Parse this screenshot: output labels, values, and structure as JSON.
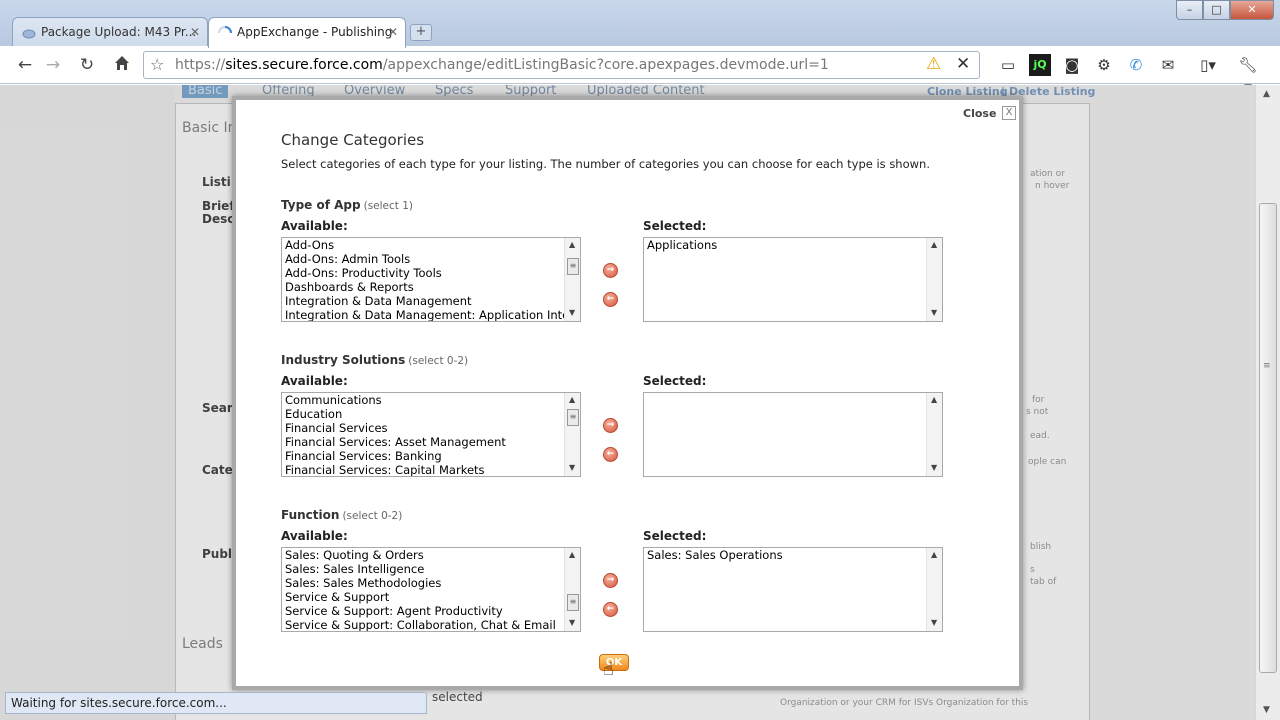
{
  "browser": {
    "tabs": [
      {
        "title": "Package Upload: M43 Pr...",
        "active": false
      },
      {
        "title": "AppExchange - Publishing",
        "active": true
      }
    ],
    "new_tab_symbol": "+",
    "url_scheme": "https://",
    "url_host": "sites.secure.force.com",
    "url_path": "/appexchange/editListingBasic?core.apexpages.devmode.url=1",
    "status_text": "Waiting for sites.secure.force.com...",
    "window_controls": {
      "minimize": "–",
      "maximize": "□",
      "close": "✕"
    },
    "extension_icons": [
      "window-icon",
      "jq-icon",
      "camera-icon",
      "gear-icon",
      "phone-icon",
      "gmail-icon",
      "page-icon",
      "wrench-icon"
    ]
  },
  "page_behind": {
    "tabs": [
      "Basic",
      "Offering",
      "Overview",
      "Specs",
      "Support",
      "Uploaded Content"
    ],
    "links": [
      "Clone Listing",
      "Delete Listing"
    ],
    "separator": "|",
    "sections": [
      "Basic In",
      "Leads"
    ],
    "labels": [
      "Listi",
      "Brief",
      "Desc",
      "Sear",
      "Cate",
      "Publ"
    ],
    "side_notes": [
      "ation or",
      "n hover",
      "for",
      "s not",
      "ead.",
      "ople can",
      "blish",
      "s",
      "tab of"
    ],
    "bottom_text": "selected",
    "bottom_note_1": "Organization or your CRM for ISVs Organization for this",
    "selected_tab": "Basic"
  },
  "modal": {
    "close_label": "Close",
    "close_x": "X",
    "title": "Change Categories",
    "description": "Select categories of each type for your listing. The number of categories you can choose for each type is shown.",
    "available_label": "Available:",
    "selected_label": "Selected:",
    "ok_label": "OK",
    "categories": [
      {
        "title": "Type of App",
        "hint": "(select 1)",
        "available": [
          "Add-Ons",
          "Add-Ons: Admin Tools",
          "Add-Ons: Productivity Tools",
          "Dashboards & Reports",
          "Integration & Data Management",
          "Integration & Data Management: Application Inte"
        ],
        "selected": [
          "Applications"
        ]
      },
      {
        "title": "Industry Solutions",
        "hint": "(select 0-2)",
        "available": [
          "Communications",
          "Education",
          "Financial Services",
          "Financial Services: Asset Management",
          "Financial Services: Banking",
          "Financial Services: Capital Markets"
        ],
        "selected": []
      },
      {
        "title": "Function",
        "hint": "(select 0-2)",
        "available": [
          "Sales: Quoting & Orders",
          "Sales: Sales Intelligence",
          "Sales: Sales Methodologies",
          "Service & Support",
          "Service & Support: Agent Productivity",
          "Service & Support: Collaboration, Chat & Email"
        ],
        "selected": [
          "Sales: Sales Operations"
        ]
      }
    ]
  },
  "colors": {
    "accent_tab": "#7fa9d4",
    "ok_button": "#f08a1c",
    "move_button": "#d6553a"
  }
}
